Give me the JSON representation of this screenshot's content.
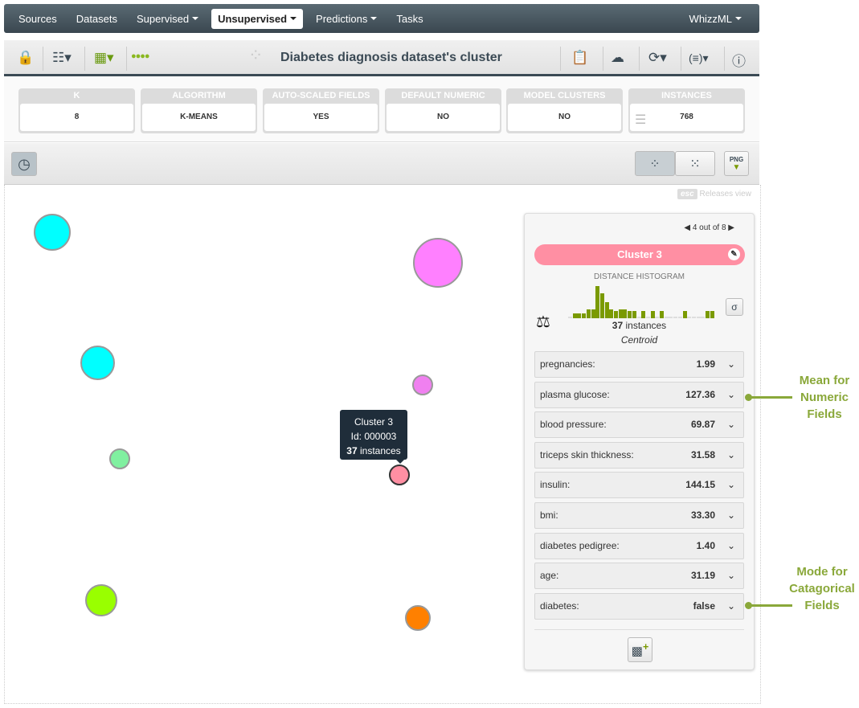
{
  "nav": {
    "items": [
      "Sources",
      "Datasets",
      "Supervised",
      "Unsupervised",
      "Predictions",
      "Tasks"
    ],
    "right": "WhizzML",
    "active": "Unsupervised"
  },
  "toolbar": {
    "title": "Diabetes diagnosis dataset's cluster"
  },
  "metrics": [
    {
      "label": "K",
      "value": "8"
    },
    {
      "label": "ALGORITHM",
      "value": "K-MEANS"
    },
    {
      "label": "AUTO-SCALED FIELDS",
      "value": "YES"
    },
    {
      "label": "DEFAULT NUMERIC",
      "value": "NO"
    },
    {
      "label": "MODEL CLUSTERS",
      "value": "NO"
    },
    {
      "label": "INSTANCES",
      "value": "768"
    }
  ],
  "canvas": {
    "esc_key": "esc",
    "esc_label": "Releases view"
  },
  "clusters": [
    {
      "color": "#00ffff"
    },
    {
      "color": "#ff80ff"
    },
    {
      "color": "#00ffff"
    },
    {
      "color": "#f080f0"
    },
    {
      "color": "#80f0a0"
    },
    {
      "color": "#ff8fa3"
    },
    {
      "color": "#99ff00"
    },
    {
      "color": "#ff8000"
    }
  ],
  "tooltip": {
    "name": "Cluster 3",
    "id": "Id: 000003",
    "count": "37",
    "count_label": " instances"
  },
  "panel": {
    "pager": "4 out of 8",
    "cluster_name": "Cluster 3",
    "cluster_color": "#ff8fa3",
    "histogram_title": "DISTANCE HISTOGRAM",
    "histogram": [
      0,
      1,
      1,
      1,
      2,
      2,
      7,
      5.5,
      3.5,
      2,
      1.5,
      2,
      2,
      1.5,
      1.5,
      0,
      1.5,
      0,
      1.5,
      0,
      1.5,
      0,
      0,
      0,
      0,
      1.5,
      0,
      0,
      0,
      0,
      1.5,
      1.5
    ],
    "sigma": "σ",
    "instances": "37",
    "instances_label": " instances",
    "centroid": "Centroid",
    "fields": [
      {
        "name": "pregnancies:",
        "value": "1.99"
      },
      {
        "name": "plasma glucose:",
        "value": "127.36"
      },
      {
        "name": "blood pressure:",
        "value": "69.87"
      },
      {
        "name": "triceps skin thickness:",
        "value": "31.58"
      },
      {
        "name": "insulin:",
        "value": "144.15"
      },
      {
        "name": "bmi:",
        "value": "33.30"
      },
      {
        "name": "diabetes pedigree:",
        "value": "1.40"
      },
      {
        "name": "age:",
        "value": "31.19"
      },
      {
        "name": "diabetes:",
        "value": "false"
      }
    ]
  },
  "annotations": {
    "numeric": "Mean for Numeric Fields",
    "categorical": "Mode for Catagorical Fields"
  }
}
